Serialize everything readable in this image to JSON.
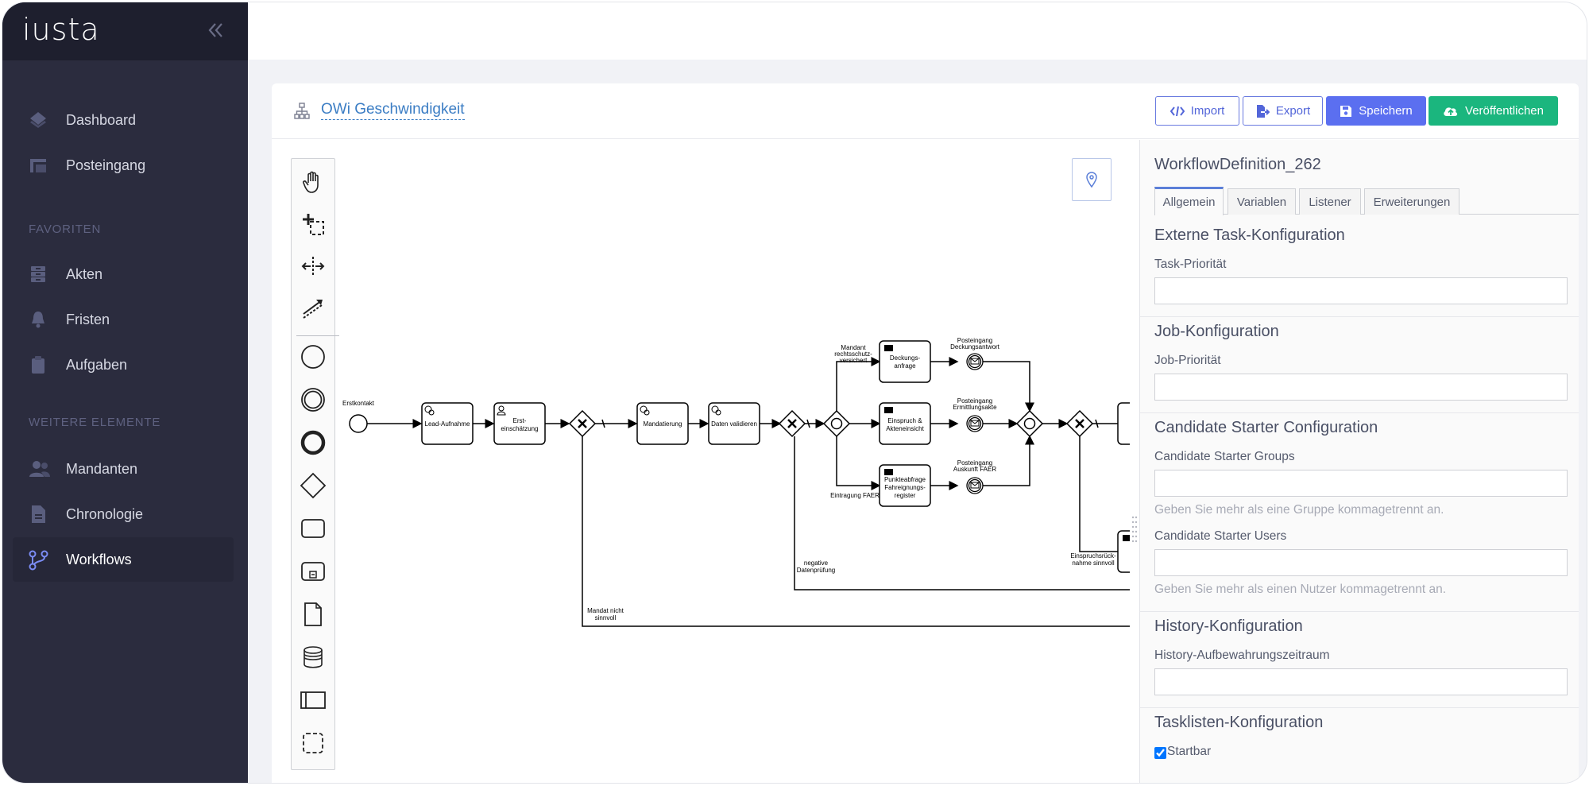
{
  "app": {
    "logo": "iusta",
    "collapse_icon": "double-chevron-left-icon"
  },
  "sidebar": {
    "items_top": [
      {
        "label": "Dashboard",
        "icon": "layers-icon"
      },
      {
        "label": "Posteingang",
        "icon": "inbox-tray-icon"
      }
    ],
    "favorites_title": "FAVORITEN",
    "favorites": [
      {
        "label": "Akten",
        "icon": "file-cabinet-icon"
      },
      {
        "label": "Fristen",
        "icon": "bell-icon"
      },
      {
        "label": "Aufgaben",
        "icon": "clipboard-icon"
      }
    ],
    "more_title": "WEITERE ELEMENTE",
    "more": [
      {
        "label": "Mandanten",
        "icon": "users-icon"
      },
      {
        "label": "Chronologie",
        "icon": "document-icon"
      },
      {
        "label": "Workflows",
        "icon": "workflow-icon",
        "active": true
      }
    ]
  },
  "header": {
    "title": "OWi Geschwindigkeit",
    "import_label": "Import",
    "export_label": "Export",
    "save_label": "Speichern",
    "publish_label": "Veröffentlichen"
  },
  "diagram": {
    "labels": {
      "erstkontakt": "Erstkontakt",
      "lead": "Lead-Aufnahme",
      "erst1": "Erst-",
      "erst2": "einschätzung",
      "mandatierung": "Mandatierung",
      "validieren": "Daten validieren",
      "deck1": "Deckungs-",
      "deck2": "anfrage",
      "einspr1": "Einspruch &",
      "einspr2": "Akteneinsicht",
      "punkte1": "Punkteabfrage",
      "punkte2": "Fahreignungs-",
      "punkte3": "register",
      "mandant1": "Mandant",
      "mandant2": "rechtsschutz-",
      "mandant3": "versichert",
      "pe_deck1": "Posteingang",
      "pe_deck2": "Deckungsantwort",
      "pe_ermitt1": "Posteingang",
      "pe_ermitt2": "Ermittlungsakte",
      "pe_faer1": "Posteingang",
      "pe_faer2": "Auskunft FAER",
      "eintragung": "Eintragung FAER",
      "negative1": "negative",
      "negative2": "Datenprüfung",
      "mandat_nicht1": "Mandat nicht",
      "mandat_nicht2": "sinnvoll",
      "einspruchsrueck1": "Einspruchsrück-",
      "einspruchsrueck2": "nahme sinnvoll"
    }
  },
  "properties": {
    "title": "WorkflowDefinition_262",
    "tabs": [
      "Allgemein",
      "Variablen",
      "Listener",
      "Erweiterungen"
    ],
    "external_task_title": "Externe Task-Konfiguration",
    "task_priority_label": "Task-Priorität",
    "task_priority_value": "",
    "job_title": "Job-Konfiguration",
    "job_priority_label": "Job-Priorität",
    "job_priority_value": "",
    "candidate_title": "Candidate Starter Configuration",
    "groups_label": "Candidate Starter Groups",
    "groups_value": "",
    "groups_hint": "Geben Sie mehr als eine Gruppe kommagetrennt an.",
    "users_label": "Candidate Starter Users",
    "users_value": "",
    "users_hint": "Geben Sie mehr als einen Nutzer kommagetrennt an.",
    "history_title": "History-Konfiguration",
    "history_label": "History-Aufbewahrungszeitraum",
    "history_value": "",
    "tasklist_title": "Tasklisten-Konfiguration",
    "startbar_label": "Startbar",
    "startbar_checked": true
  }
}
